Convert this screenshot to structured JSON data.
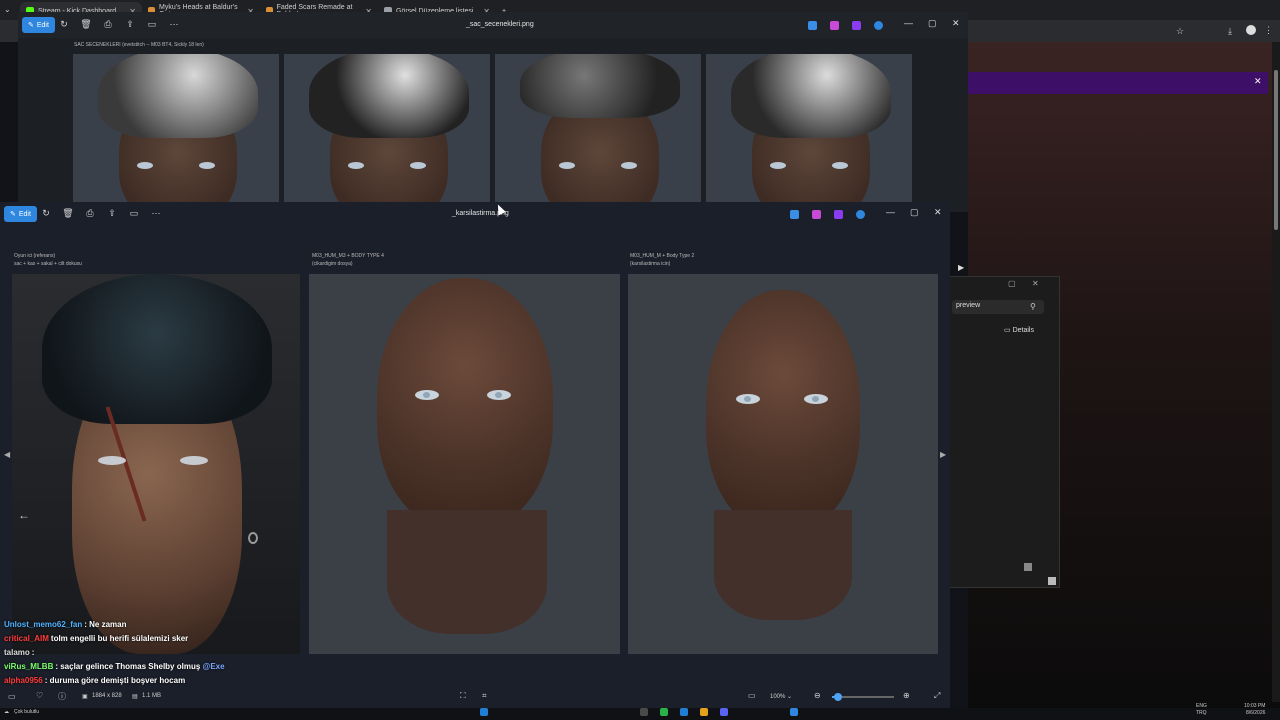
{
  "browser": {
    "tabs": [
      {
        "label": "Stream - Kick Dashboard",
        "icon": "kick-icon",
        "color": "#53fc18"
      },
      {
        "label": "Myku's Heads at Baldur's Gate",
        "icon": "nexus-icon",
        "color": "#da8e35"
      },
      {
        "label": "Faded Scars Remade at Baldur's",
        "icon": "nexus-icon",
        "color": "#da8e35"
      },
      {
        "label": "Görsel Düzenleme listesi",
        "icon": "doc-icon",
        "color": "#9aa0a6"
      }
    ],
    "new_tab": "+"
  },
  "window1": {
    "edit_label": "Edit",
    "title": "_sac_secenekleri.png",
    "caption": "SAC SECENEKLERI (evetstitch -- M03 BT4, Sickly 18 len)"
  },
  "window2": {
    "edit_label": "Edit",
    "title": "_karsilastirma.png",
    "captions": [
      {
        "line1": "Oyun ici (referans)",
        "line2": "sac + kas + sakal + cilt dokusu"
      },
      {
        "line1": "M03_HUM_M3 + BODY TYPE 4",
        "line2": "(cikardigim dosya)"
      },
      {
        "line1": "M03_HUM_M + Body Type 2",
        "line2": "(karsilastirma icin)"
      }
    ],
    "status": {
      "dimensions": "1884 x 828",
      "size": "1.1 MB",
      "zoom": "100%",
      "zoom_fraction": 0.1
    }
  },
  "explorer": {
    "search_value": "preview",
    "details_label": "Details"
  },
  "chat": [
    {
      "user": "Unlost_memo62_fan",
      "user_color": "#4fb3ff",
      "message": ": Ne zaman"
    },
    {
      "user": "critical_AIM",
      "user_color": "#ff3b3b",
      "message": "tolm engelli bu herifi sülalemizi sker"
    },
    {
      "user": "talamo",
      "user_color": "#dddddd",
      "message": ":"
    },
    {
      "user": "viRus_MLBB",
      "user_color": "#7cff6b",
      "message": ": saçlar gelince Thomas Shelby olmuş",
      "mention": "@Exe"
    },
    {
      "user": "alpha0956",
      "user_color": "#ff3b3b",
      "message": ": duruma göre demişti boşver hocam"
    }
  ],
  "taskbar": {
    "left_label": "Çok bulutlu",
    "lang_top": "ENG",
    "lang_bottom": "TRQ",
    "time": "10:03 PM",
    "date": "8/6/2026"
  }
}
